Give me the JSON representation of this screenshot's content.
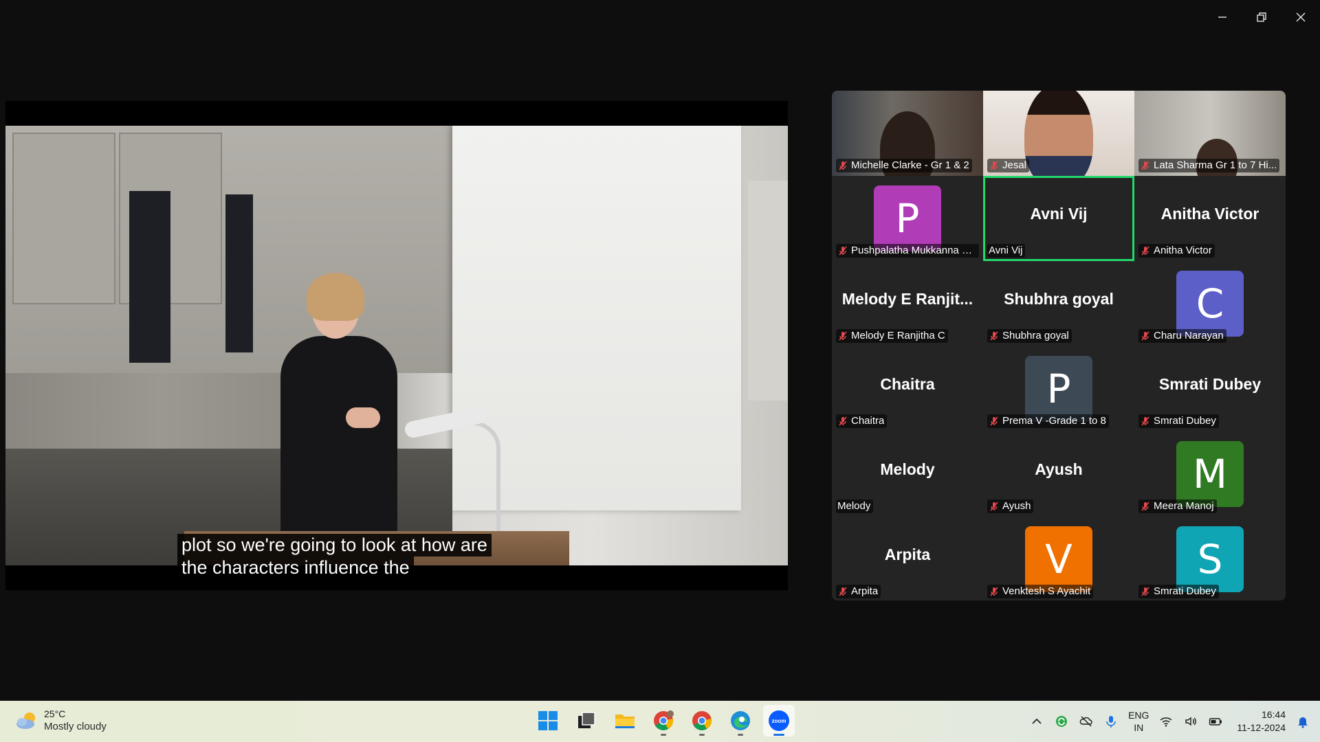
{
  "window": {
    "controls": [
      "minimize",
      "restore",
      "close"
    ]
  },
  "shared_video": {
    "captions": [
      "plot so we're going to look at how are",
      "the characters influence the"
    ]
  },
  "gallery": {
    "tiles": [
      {
        "label": "Michelle Clarke - Gr 1 & 2",
        "muted": true,
        "type": "camera"
      },
      {
        "label": "Jesal",
        "muted": true,
        "type": "camera"
      },
      {
        "label": "Lata Sharma Gr 1 to 7 Hi...",
        "muted": true,
        "type": "camera"
      },
      {
        "label": "Pushpalatha Mukkanna E...",
        "muted": true,
        "type": "avatar",
        "initial": "P",
        "color": "#b13cb8"
      },
      {
        "label": "Avni Vij",
        "display": "Avni Vij",
        "muted": false,
        "type": "name",
        "active": true
      },
      {
        "label": "Anitha Victor",
        "display": "Anitha Victor",
        "muted": true,
        "type": "name"
      },
      {
        "label": "Melody E Ranjitha C",
        "display": "Melody  E  Ranjit...",
        "muted": true,
        "type": "name"
      },
      {
        "label": "Shubhra goyal",
        "display": "Shubhra goyal",
        "muted": true,
        "type": "name"
      },
      {
        "label": "Charu Narayan",
        "muted": true,
        "type": "avatar",
        "initial": "C",
        "color": "#5b5fc7"
      },
      {
        "label": "Chaitra",
        "display": "Chaitra",
        "muted": true,
        "type": "name"
      },
      {
        "label": "Prema V  -Grade  1 to 8",
        "muted": true,
        "type": "avatar",
        "initial": "P",
        "color": "#3d4a56"
      },
      {
        "label": "Smrati Dubey",
        "display": "Smrati Dubey",
        "muted": true,
        "type": "name"
      },
      {
        "label": "Melody",
        "display": "Melody",
        "muted": false,
        "type": "name"
      },
      {
        "label": "Ayush",
        "display": "Ayush",
        "muted": true,
        "type": "name"
      },
      {
        "label": "Meera Manoj",
        "muted": true,
        "type": "avatar",
        "initial": "M",
        "color": "#2f7a23"
      },
      {
        "label": "Arpita",
        "display": "Arpita",
        "muted": true,
        "type": "name"
      },
      {
        "label": "Venktesh S Ayachit",
        "muted": true,
        "type": "avatar",
        "initial": "V",
        "color": "#f07000"
      },
      {
        "label": "Smrati Dubey",
        "muted": true,
        "type": "avatar",
        "initial": "S",
        "color": "#10a5b5"
      }
    ]
  },
  "taskbar": {
    "weather": {
      "temp": "25°C",
      "condition": "Mostly cloudy",
      "icon": "partly-cloudy-icon"
    },
    "apps": [
      {
        "name": "start-button",
        "icon": "windows-logo-icon"
      },
      {
        "name": "task-view",
        "icon": "task-view-icon"
      },
      {
        "name": "file-explorer",
        "icon": "folder-icon"
      },
      {
        "name": "chrome-profile-1",
        "icon": "chrome-icon",
        "running": true
      },
      {
        "name": "chrome-profile-2",
        "icon": "chrome-icon",
        "running": true
      },
      {
        "name": "edge",
        "icon": "edge-icon",
        "running": true
      },
      {
        "name": "zoom",
        "icon": "zoom-icon",
        "running": true,
        "active": true,
        "label": "zoom"
      }
    ],
    "tray": {
      "lang_top": "ENG",
      "lang_bottom": "IN",
      "time": "16:44",
      "date": "11-12-2024"
    }
  },
  "colors": {
    "active_speaker_border": "#23d96b",
    "mute_icon": "#e5484d",
    "gallery_bg": "#242424",
    "zoom_blue": "#0b5cff"
  }
}
